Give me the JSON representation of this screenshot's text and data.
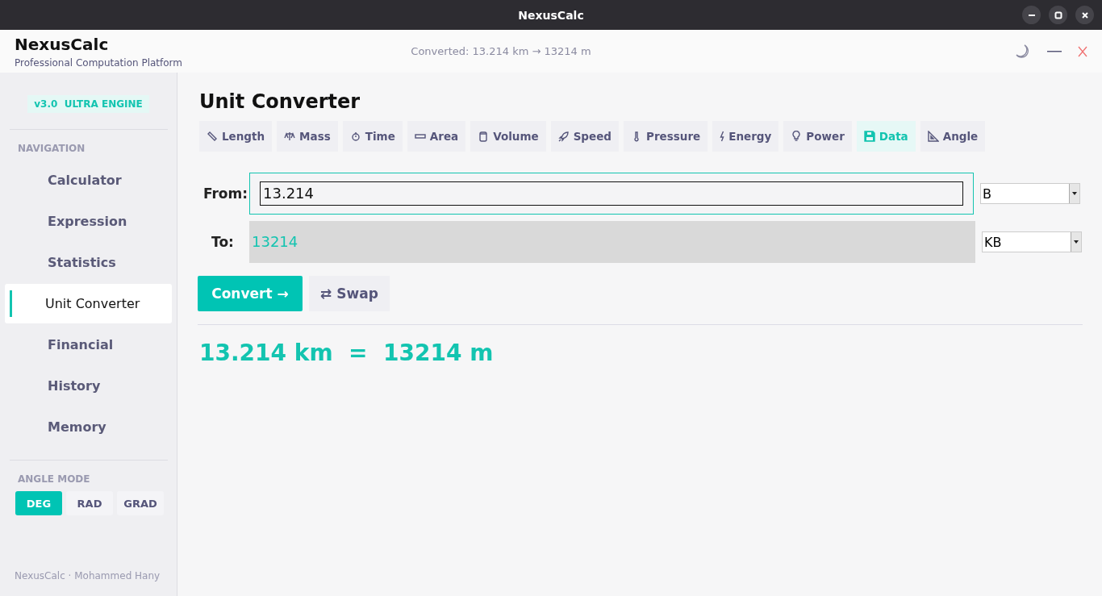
{
  "window": {
    "title": "NexusCalc"
  },
  "header": {
    "app_name": "NexusCalc",
    "subtitle": "Professional Computation Platform",
    "status": "Converted: 13.214 km → 13214 m"
  },
  "sidebar": {
    "badge": "v3.0  ULTRA ENGINE",
    "nav_heading": "NAVIGATION",
    "items": [
      {
        "label": "Calculator",
        "selected": false
      },
      {
        "label": "Expression",
        "selected": false
      },
      {
        "label": "Statistics",
        "selected": false
      },
      {
        "label": "Unit Converter",
        "selected": true
      },
      {
        "label": "Financial",
        "selected": false
      },
      {
        "label": "History",
        "selected": false
      },
      {
        "label": "Memory",
        "selected": false
      }
    ],
    "angle_heading": "ANGLE MODE",
    "angle_modes": [
      {
        "label": "DEG",
        "selected": true
      },
      {
        "label": "RAD",
        "selected": false
      },
      {
        "label": "GRAD",
        "selected": false
      }
    ],
    "footer": "NexusCalc · Mohammed Hany"
  },
  "page": {
    "title": "Unit Converter",
    "tabs": [
      {
        "label": "Length",
        "selected": false
      },
      {
        "label": "Mass",
        "selected": false
      },
      {
        "label": "Time",
        "selected": false
      },
      {
        "label": "Area",
        "selected": false
      },
      {
        "label": "Volume",
        "selected": false
      },
      {
        "label": "Speed",
        "selected": false
      },
      {
        "label": "Pressure",
        "selected": false
      },
      {
        "label": "Energy",
        "selected": false
      },
      {
        "label": "Power",
        "selected": false
      },
      {
        "label": "Data",
        "selected": true
      },
      {
        "label": "Angle",
        "selected": false
      }
    ],
    "from": {
      "label": "From:",
      "value": "13.214",
      "unit": "B"
    },
    "to": {
      "label": "To:",
      "value": "13214",
      "unit": "KB"
    },
    "convert_button": "Convert →",
    "swap_button": "⇄ Swap",
    "result": "13.214 km  =  13214 m"
  }
}
